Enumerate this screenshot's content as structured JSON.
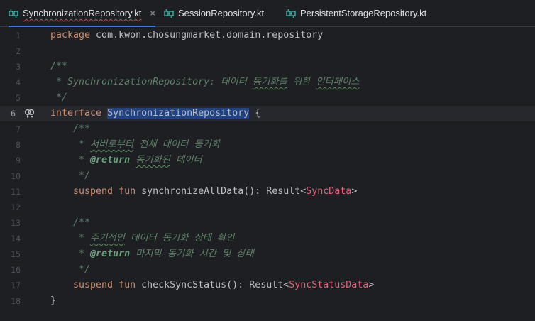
{
  "tabs": [
    {
      "label": "SynchronizationRepository.kt",
      "active": true,
      "close": "×"
    },
    {
      "label": "SessionRepository.kt",
      "active": false
    },
    {
      "label": "PersistentStorageRepository.kt",
      "active": false
    }
  ],
  "colors": {
    "accent": "#3574f0",
    "keyword": "#cf8e6d",
    "doc": "#5f826b",
    "type_param": "#c77dbb"
  },
  "editor": {
    "current_line": 6,
    "line_numbers": [
      "1",
      "2",
      "3",
      "4",
      "5",
      "6",
      "7",
      "8",
      "9",
      "10",
      "11",
      "12",
      "13",
      "14",
      "15",
      "16",
      "17",
      "18"
    ],
    "lines": {
      "l1": {
        "kw": "package",
        "rest": " com.kwon.chosungmarket.domain.repository"
      },
      "l3": {
        "text": "/**"
      },
      "l4": {
        "prefix": " * SynchronizationRepository: 데이터 ",
        "w1": "동기화를",
        "mid": " 위한 ",
        "w2": "인터페이스"
      },
      "l5": {
        "text": " */"
      },
      "l6": {
        "kw": "interface",
        "name": "SynchronizationRepository",
        "rest": " {"
      },
      "l7": {
        "text": "    /**"
      },
      "l8": {
        "star": "     * ",
        "w1": "서버로부터",
        "rest": " 전체 데이터 동기화"
      },
      "l9": {
        "star": "     * ",
        "tag": "@return",
        "sp": " ",
        "w1": "동기화된",
        "rest": " 데이터"
      },
      "l10": {
        "text": "     */"
      },
      "l11": {
        "kw": "    suspend fun",
        "name": " synchronizeAllData(): Result<",
        "type": "SyncData",
        "end": ">"
      },
      "l13": {
        "text": "    /**"
      },
      "l14": {
        "star": "     * ",
        "w1": "주기적인",
        "rest": " 데이터 동기화 상태 확인"
      },
      "l15": {
        "star": "     * ",
        "tag": "@return",
        "rest": " 마지막 동기화 시간 및 상태"
      },
      "l16": {
        "text": "     */"
      },
      "l17": {
        "kw": "    suspend fun",
        "name": " checkSyncStatus(): Result<",
        "type": "SyncStatusData",
        "end": ">"
      },
      "l18": {
        "text": "}"
      }
    }
  }
}
